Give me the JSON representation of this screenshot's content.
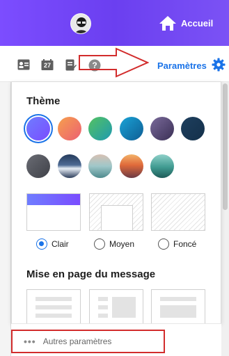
{
  "header": {
    "home_label": "Accueil"
  },
  "nav": {
    "calendar_day": "27",
    "settings_label": "Paramètres"
  },
  "panel": {
    "theme_title": "Thème",
    "theme_colors": [
      {
        "name": "bleu-violet",
        "gradient": "linear-gradient(135deg,#6f7dff,#7a4cff)"
      },
      {
        "name": "orange-rose",
        "gradient": "linear-gradient(135deg,#f6a04d,#ec5f73)"
      },
      {
        "name": "vert-bleu",
        "gradient": "linear-gradient(135deg,#55c261,#1e9ab0)"
      },
      {
        "name": "bleu",
        "gradient": "linear-gradient(135deg,#1aa3d6,#0e5d94)"
      },
      {
        "name": "violet-sombre",
        "gradient": "linear-gradient(135deg,#7a6a9a,#3a2f55)"
      },
      {
        "name": "bleu-nuit",
        "gradient": "linear-gradient(135deg,#1e3f5e,#14304a)"
      },
      {
        "name": "gris-ardoise",
        "gradient": "linear-gradient(135deg,#6a6c74,#3f4148)"
      }
    ],
    "image_themes": [
      {
        "name": "montagne",
        "gradient": "linear-gradient(180deg,#253b5c 0%,#4d6a93 45%,#e8eef6 60%,#2b3d5a 100%)"
      },
      {
        "name": "plage",
        "gradient": "linear-gradient(180deg,#d7c1b4 0%,#9fc7c9 50%,#4e8a8d 100%)"
      },
      {
        "name": "coucher-de-soleil",
        "gradient": "linear-gradient(180deg,#f3b36a 0%,#e06a3a 45%,#6b3a45 100%)"
      },
      {
        "name": "vallee",
        "gradient": "linear-gradient(180deg,#8fd0c9 0%,#3f9a90 55%,#1f5b58 100%)"
      }
    ],
    "layout_options": [
      {
        "label": "Clair",
        "checked": true
      },
      {
        "label": "Moyen",
        "checked": false
      },
      {
        "label": "Foncé",
        "checked": false
      }
    ],
    "message_layout_title": "Mise en page du message"
  },
  "footer": {
    "more_label": "Autres paramètres",
    "dots": "•••"
  },
  "colors": {
    "accent": "#1a73e8",
    "header": "#7c4dff",
    "annotation": "#d22c2c"
  }
}
